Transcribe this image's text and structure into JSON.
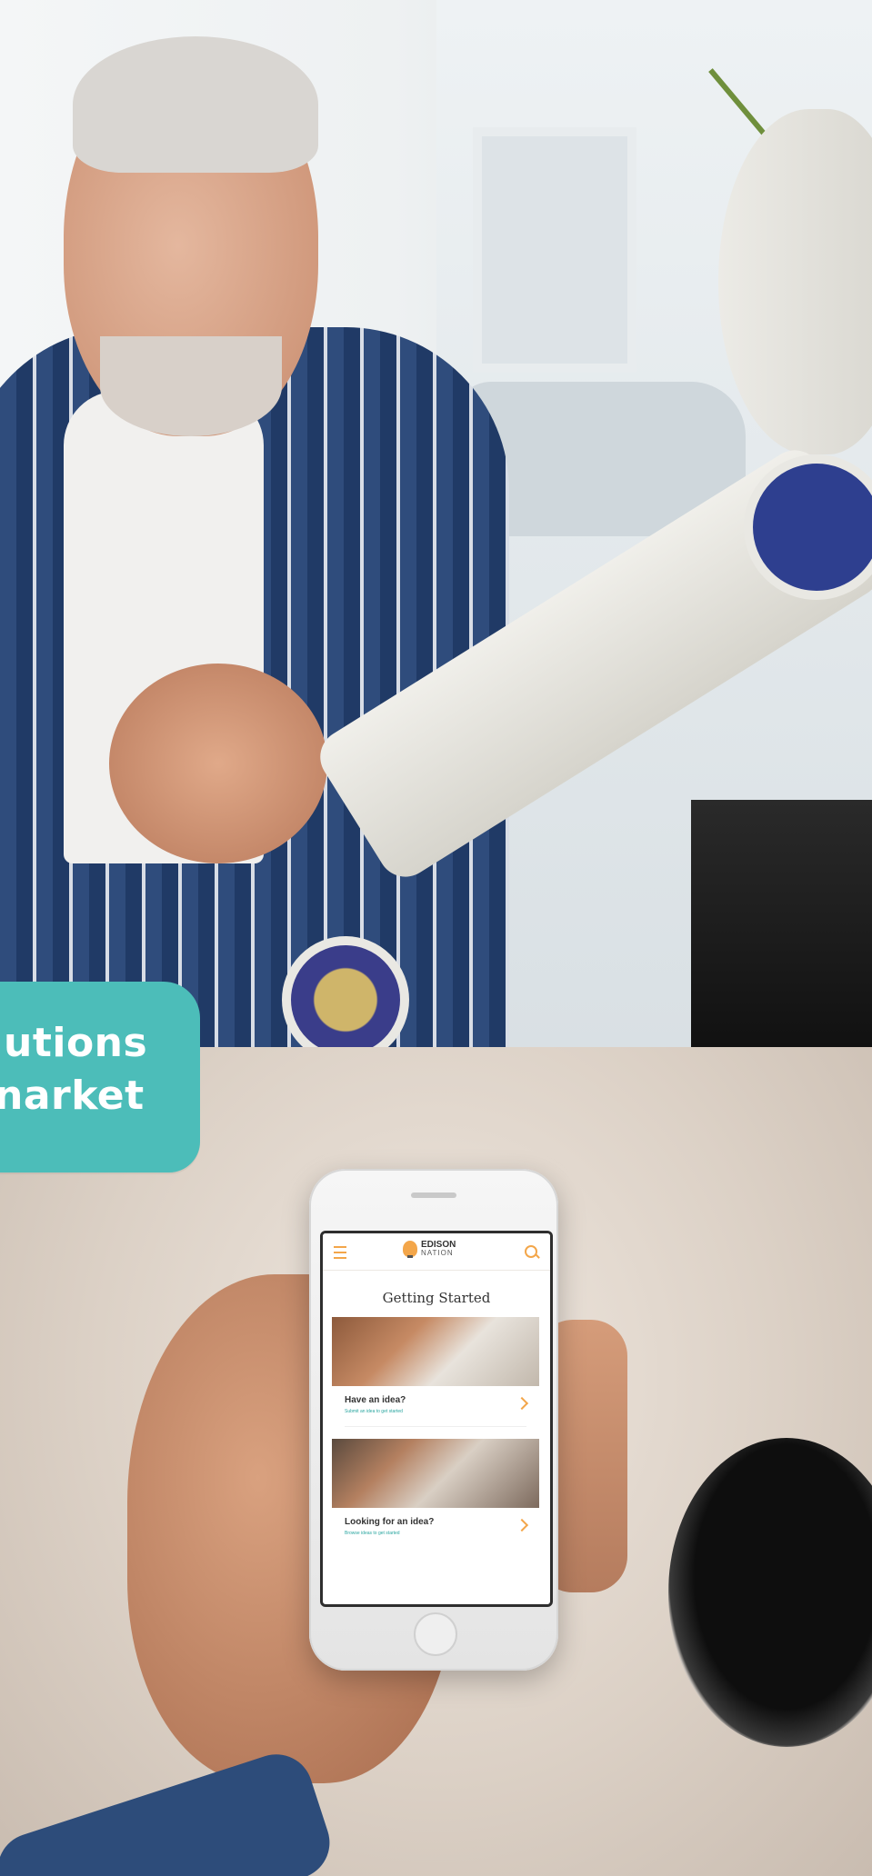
{
  "callout": {
    "line1": "utions",
    "line2": "narket"
  },
  "phone_app": {
    "logo": {
      "name": "EDISON",
      "sub": "NATION"
    },
    "page_title": "Getting Started",
    "cards": [
      {
        "title": "Have an idea?",
        "subtitle": "Submit an idea to get started",
        "icon": "chevron-right-icon"
      },
      {
        "title": "Looking for an idea?",
        "subtitle": "Browse ideas to get started",
        "icon": "chevron-right-icon"
      }
    ],
    "icons": {
      "menu": "menu-icon",
      "search": "search-icon"
    }
  },
  "colors": {
    "callout": "#4cbdb9",
    "accent": "#f3a64a",
    "teal_text": "#2aa6a0"
  }
}
